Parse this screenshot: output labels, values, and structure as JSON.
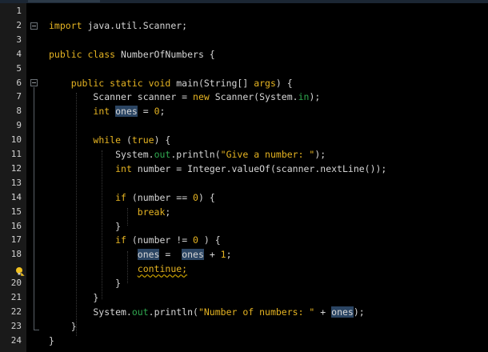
{
  "editor": {
    "accent": "#e6b422",
    "field_color": "#2fa84f",
    "highlight_color": "#2b4563",
    "line_numbers": [
      "1",
      "2",
      "3",
      "4",
      "5",
      "6",
      "7",
      "8",
      "9",
      "10",
      "11",
      "12",
      "13",
      "14",
      "15",
      "16",
      "17",
      "18",
      "",
      "20",
      "21",
      "22",
      "23",
      "24"
    ],
    "lines": [
      [],
      [
        {
          "t": "import",
          "c": "kw"
        },
        {
          "t": " java.util.Scanner;",
          "c": "tx"
        }
      ],
      [],
      [
        {
          "t": "public class",
          "c": "kw"
        },
        {
          "t": " NumberOfNumbers {",
          "c": "tx"
        }
      ],
      [],
      [
        {
          "t": "    public static void",
          "c": "kw"
        },
        {
          "t": " main(String[] ",
          "c": "tx"
        },
        {
          "t": "args",
          "c": "kw"
        },
        {
          "t": ") {",
          "c": "tx"
        }
      ],
      [
        {
          "t": "        Scanner scanner = ",
          "c": "tx"
        },
        {
          "t": "new",
          "c": "kw"
        },
        {
          "t": " Scanner(System.",
          "c": "tx"
        },
        {
          "t": "in",
          "c": "fld"
        },
        {
          "t": ");",
          "c": "tx"
        }
      ],
      [
        {
          "t": "        ",
          "c": "tx"
        },
        {
          "t": "int",
          "c": "kw"
        },
        {
          "t": " ",
          "c": "tx"
        },
        {
          "t": "ones",
          "c": "hl"
        },
        {
          "t": " = ",
          "c": "tx"
        },
        {
          "t": "0",
          "c": "num"
        },
        {
          "t": ";",
          "c": "tx"
        }
      ],
      [],
      [
        {
          "t": "        ",
          "c": "tx"
        },
        {
          "t": "while",
          "c": "kw"
        },
        {
          "t": " (",
          "c": "tx"
        },
        {
          "t": "true",
          "c": "kw"
        },
        {
          "t": ") {",
          "c": "tx"
        }
      ],
      [
        {
          "t": "            System.",
          "c": "tx"
        },
        {
          "t": "out",
          "c": "fld"
        },
        {
          "t": ".println(",
          "c": "tx"
        },
        {
          "t": "\"Give a number: \"",
          "c": "str"
        },
        {
          "t": ");",
          "c": "tx"
        }
      ],
      [
        {
          "t": "            ",
          "c": "tx"
        },
        {
          "t": "int",
          "c": "kw"
        },
        {
          "t": " number = Integer.valueOf(scanner.nextLine());",
          "c": "tx"
        }
      ],
      [],
      [
        {
          "t": "            ",
          "c": "tx"
        },
        {
          "t": "if",
          "c": "kw"
        },
        {
          "t": " (number == ",
          "c": "tx"
        },
        {
          "t": "0",
          "c": "num"
        },
        {
          "t": ") {",
          "c": "tx"
        }
      ],
      [
        {
          "t": "                ",
          "c": "tx"
        },
        {
          "t": "break",
          "c": "kw"
        },
        {
          "t": ";",
          "c": "tx"
        }
      ],
      [
        {
          "t": "            }",
          "c": "tx"
        }
      ],
      [
        {
          "t": "            ",
          "c": "tx"
        },
        {
          "t": "if",
          "c": "kw"
        },
        {
          "t": " (number != ",
          "c": "tx"
        },
        {
          "t": "0",
          "c": "num"
        },
        {
          "t": " ) {",
          "c": "tx"
        }
      ],
      [
        {
          "t": "                ",
          "c": "tx"
        },
        {
          "t": "ones",
          "c": "hl"
        },
        {
          "t": " =  ",
          "c": "tx"
        },
        {
          "t": "ones",
          "c": "hl"
        },
        {
          "t": " + ",
          "c": "tx"
        },
        {
          "t": "1",
          "c": "num"
        },
        {
          "t": ";",
          "c": "tx"
        }
      ],
      [
        {
          "t": "                ",
          "c": "tx"
        },
        {
          "t": "continue;",
          "c": "kw wavy"
        }
      ],
      [
        {
          "t": "            }",
          "c": "tx"
        }
      ],
      [
        {
          "t": "        }",
          "c": "tx"
        }
      ],
      [
        {
          "t": "        System.",
          "c": "tx"
        },
        {
          "t": "out",
          "c": "fld"
        },
        {
          "t": ".println(",
          "c": "tx"
        },
        {
          "t": "\"Number of numbers: \"",
          "c": "str"
        },
        {
          "t": " + ",
          "c": "tx"
        },
        {
          "t": "ones",
          "c": "hl"
        },
        {
          "t": ");",
          "c": "tx"
        }
      ],
      [
        {
          "t": "    }",
          "c": "tx"
        }
      ],
      [
        {
          "t": "}",
          "c": "tx"
        }
      ]
    ],
    "hint_icon": "lightbulb-warning-icon",
    "fold_icon": "collapse-minus-icon"
  }
}
